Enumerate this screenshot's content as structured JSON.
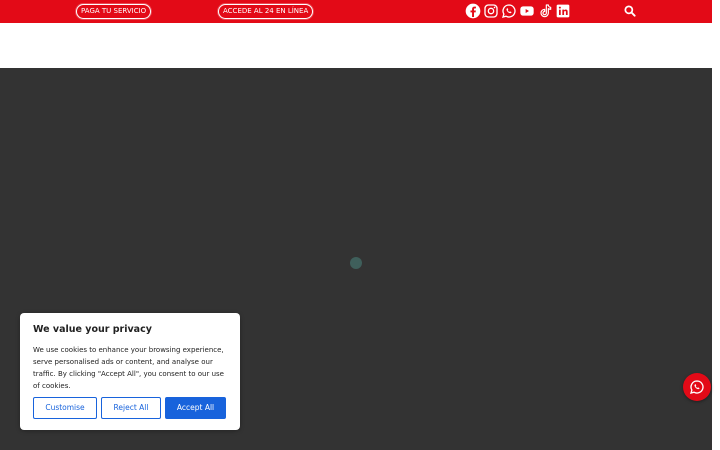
{
  "topbar": {
    "pay_label": "PAGA TU SERVICIO",
    "access_label": "ACCEDE AL 24 EN LÍNEA",
    "social_icons": [
      "facebook-icon",
      "instagram-icon",
      "whatsapp-icon",
      "youtube-icon",
      "tiktok-icon",
      "linkedin-icon"
    ],
    "search_icon": "search-icon"
  },
  "cookie_banner": {
    "title": "We value your privacy",
    "body": "We use cookies to enhance your browsing experience, serve personalised ads or content, and analyse our traffic. By clicking \"Accept All\", you consent to our use of cookies.",
    "customise_label": "Customise",
    "reject_label": "Reject All",
    "accept_label": "Accept All"
  },
  "floating_button": {
    "icon": "whatsapp-icon"
  },
  "colors": {
    "brand_red": "#e30a17",
    "hero_bg": "#333333",
    "accent_blue": "#1863dc",
    "loader": "#3f5f5b"
  }
}
